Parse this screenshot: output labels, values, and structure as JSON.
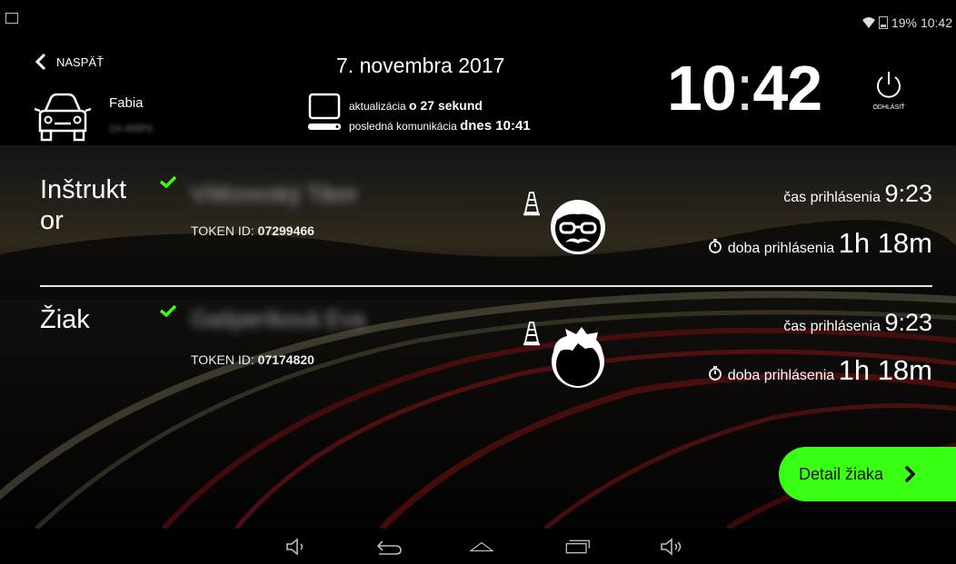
{
  "status_bar": {
    "battery": "19%",
    "time": "10:42"
  },
  "header": {
    "back_label": "NASPÄŤ",
    "car_name": "Fabia",
    "car_plate": "ZA 488FK",
    "date": "7. novembra 2017",
    "update_prefix": "aktualizácia",
    "update_value": "o 27 sekund",
    "last_comm_prefix": "posledná komunikácia",
    "last_comm_value": "dnes 10:41",
    "clock_hours": "10",
    "clock_sep": ":",
    "clock_minutes": "42",
    "logout_label": "ODHLÁSIŤ"
  },
  "rows": [
    {
      "role_line1": "Inštrukt",
      "role_line2": "or",
      "name": "Vítězovský Tibor",
      "token_prefix": "TOKEN ID: ",
      "token_id": "07299466",
      "login_label": "čas prihlásenia ",
      "login_time": "9:23",
      "duration_label": "doba prihlásenia ",
      "duration": "1h 18m"
    },
    {
      "role_line1": "Žiak",
      "name": "Gašperíková Eva",
      "token_prefix": "TOKEN ID: ",
      "token_id": "07174820",
      "login_label": "čas prihlásenia ",
      "login_time": "9:23",
      "duration_label": "doba prihlásenia ",
      "duration": "1h 18m"
    }
  ],
  "detail_button": "Detail žiaka",
  "colors": {
    "accent": "#39ff14",
    "check": "#39ff14"
  },
  "icons": [
    "wifi-icon",
    "battery-icon",
    "back-chevron-icon",
    "car-icon",
    "computer-icon",
    "power-icon",
    "check-icon",
    "traffic-cone-icon",
    "instructor-face-icon",
    "student-face-icon",
    "stopwatch-icon",
    "chevron-right-icon",
    "volume-down-icon",
    "back-icon",
    "home-icon",
    "recents-icon",
    "volume-up-icon"
  ]
}
